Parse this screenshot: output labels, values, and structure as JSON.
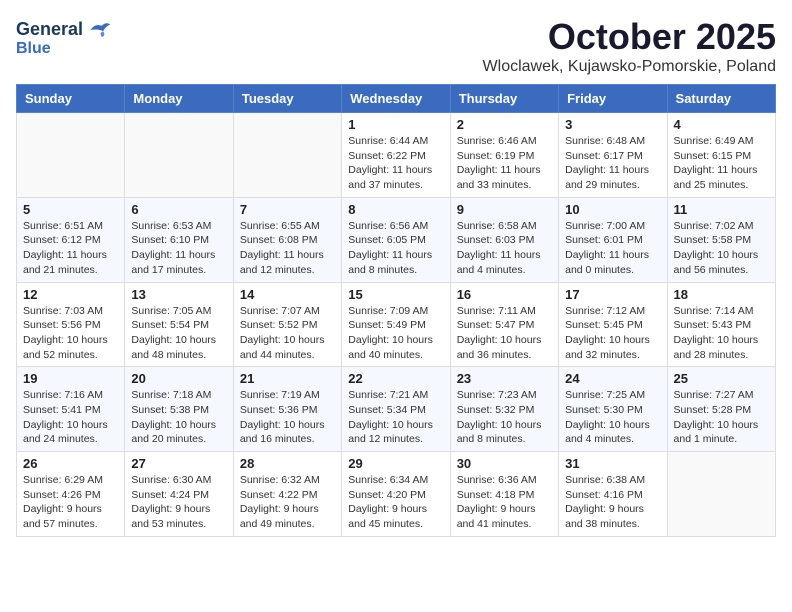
{
  "header": {
    "logo_line1": "General",
    "logo_line2": "Blue",
    "month_title": "October 2025",
    "location": "Wloclawek, Kujawsko-Pomorskie, Poland"
  },
  "weekdays": [
    "Sunday",
    "Monday",
    "Tuesday",
    "Wednesday",
    "Thursday",
    "Friday",
    "Saturday"
  ],
  "weeks": [
    [
      {
        "day": "",
        "info": ""
      },
      {
        "day": "",
        "info": ""
      },
      {
        "day": "",
        "info": ""
      },
      {
        "day": "1",
        "info": "Sunrise: 6:44 AM\nSunset: 6:22 PM\nDaylight: 11 hours\nand 37 minutes."
      },
      {
        "day": "2",
        "info": "Sunrise: 6:46 AM\nSunset: 6:19 PM\nDaylight: 11 hours\nand 33 minutes."
      },
      {
        "day": "3",
        "info": "Sunrise: 6:48 AM\nSunset: 6:17 PM\nDaylight: 11 hours\nand 29 minutes."
      },
      {
        "day": "4",
        "info": "Sunrise: 6:49 AM\nSunset: 6:15 PM\nDaylight: 11 hours\nand 25 minutes."
      }
    ],
    [
      {
        "day": "5",
        "info": "Sunrise: 6:51 AM\nSunset: 6:12 PM\nDaylight: 11 hours\nand 21 minutes."
      },
      {
        "day": "6",
        "info": "Sunrise: 6:53 AM\nSunset: 6:10 PM\nDaylight: 11 hours\nand 17 minutes."
      },
      {
        "day": "7",
        "info": "Sunrise: 6:55 AM\nSunset: 6:08 PM\nDaylight: 11 hours\nand 12 minutes."
      },
      {
        "day": "8",
        "info": "Sunrise: 6:56 AM\nSunset: 6:05 PM\nDaylight: 11 hours\nand 8 minutes."
      },
      {
        "day": "9",
        "info": "Sunrise: 6:58 AM\nSunset: 6:03 PM\nDaylight: 11 hours\nand 4 minutes."
      },
      {
        "day": "10",
        "info": "Sunrise: 7:00 AM\nSunset: 6:01 PM\nDaylight: 11 hours\nand 0 minutes."
      },
      {
        "day": "11",
        "info": "Sunrise: 7:02 AM\nSunset: 5:58 PM\nDaylight: 10 hours\nand 56 minutes."
      }
    ],
    [
      {
        "day": "12",
        "info": "Sunrise: 7:03 AM\nSunset: 5:56 PM\nDaylight: 10 hours\nand 52 minutes."
      },
      {
        "day": "13",
        "info": "Sunrise: 7:05 AM\nSunset: 5:54 PM\nDaylight: 10 hours\nand 48 minutes."
      },
      {
        "day": "14",
        "info": "Sunrise: 7:07 AM\nSunset: 5:52 PM\nDaylight: 10 hours\nand 44 minutes."
      },
      {
        "day": "15",
        "info": "Sunrise: 7:09 AM\nSunset: 5:49 PM\nDaylight: 10 hours\nand 40 minutes."
      },
      {
        "day": "16",
        "info": "Sunrise: 7:11 AM\nSunset: 5:47 PM\nDaylight: 10 hours\nand 36 minutes."
      },
      {
        "day": "17",
        "info": "Sunrise: 7:12 AM\nSunset: 5:45 PM\nDaylight: 10 hours\nand 32 minutes."
      },
      {
        "day": "18",
        "info": "Sunrise: 7:14 AM\nSunset: 5:43 PM\nDaylight: 10 hours\nand 28 minutes."
      }
    ],
    [
      {
        "day": "19",
        "info": "Sunrise: 7:16 AM\nSunset: 5:41 PM\nDaylight: 10 hours\nand 24 minutes."
      },
      {
        "day": "20",
        "info": "Sunrise: 7:18 AM\nSunset: 5:38 PM\nDaylight: 10 hours\nand 20 minutes."
      },
      {
        "day": "21",
        "info": "Sunrise: 7:19 AM\nSunset: 5:36 PM\nDaylight: 10 hours\nand 16 minutes."
      },
      {
        "day": "22",
        "info": "Sunrise: 7:21 AM\nSunset: 5:34 PM\nDaylight: 10 hours\nand 12 minutes."
      },
      {
        "day": "23",
        "info": "Sunrise: 7:23 AM\nSunset: 5:32 PM\nDaylight: 10 hours\nand 8 minutes."
      },
      {
        "day": "24",
        "info": "Sunrise: 7:25 AM\nSunset: 5:30 PM\nDaylight: 10 hours\nand 4 minutes."
      },
      {
        "day": "25",
        "info": "Sunrise: 7:27 AM\nSunset: 5:28 PM\nDaylight: 10 hours\nand 1 minute."
      }
    ],
    [
      {
        "day": "26",
        "info": "Sunrise: 6:29 AM\nSunset: 4:26 PM\nDaylight: 9 hours\nand 57 minutes."
      },
      {
        "day": "27",
        "info": "Sunrise: 6:30 AM\nSunset: 4:24 PM\nDaylight: 9 hours\nand 53 minutes."
      },
      {
        "day": "28",
        "info": "Sunrise: 6:32 AM\nSunset: 4:22 PM\nDaylight: 9 hours\nand 49 minutes."
      },
      {
        "day": "29",
        "info": "Sunrise: 6:34 AM\nSunset: 4:20 PM\nDaylight: 9 hours\nand 45 minutes."
      },
      {
        "day": "30",
        "info": "Sunrise: 6:36 AM\nSunset: 4:18 PM\nDaylight: 9 hours\nand 41 minutes."
      },
      {
        "day": "31",
        "info": "Sunrise: 6:38 AM\nSunset: 4:16 PM\nDaylight: 9 hours\nand 38 minutes."
      },
      {
        "day": "",
        "info": ""
      }
    ]
  ]
}
